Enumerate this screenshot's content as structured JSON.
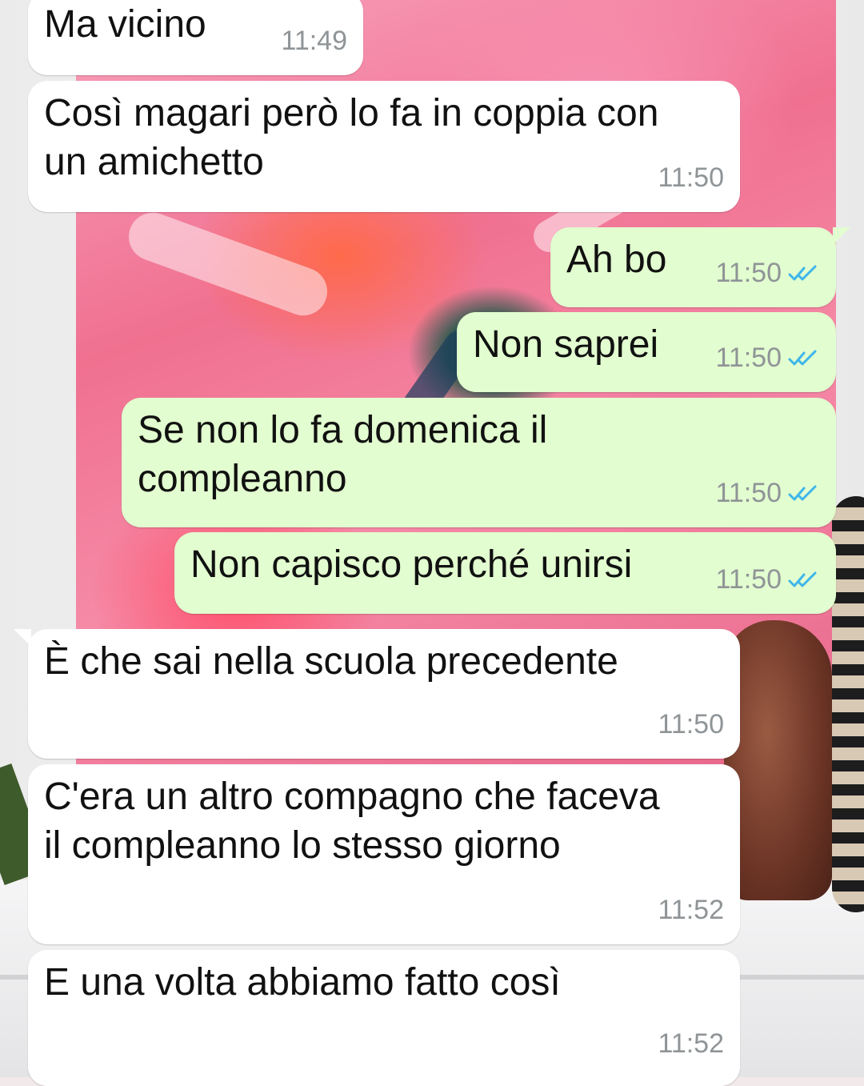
{
  "colors": {
    "incoming_bubble": "#ffffff",
    "outgoing_bubble": "#e2fdcf",
    "timestamp": "#8f9497",
    "read_ticks": "#3fb6ea"
  },
  "messages": [
    {
      "direction": "in",
      "text": "Ma vicino",
      "time": "11:49"
    },
    {
      "direction": "in",
      "text": "Così magari però lo fa in coppia con\nun amichetto",
      "time": "11:50"
    },
    {
      "direction": "out",
      "text": "Ah bo",
      "time": "11:50",
      "status": "read-ticks-icon"
    },
    {
      "direction": "out",
      "text": "Non saprei",
      "time": "11:50",
      "status": "read-ticks-icon"
    },
    {
      "direction": "out",
      "text": "Se non lo fa domenica il\ncompleanno",
      "time": "11:50",
      "status": "read-ticks-icon"
    },
    {
      "direction": "out",
      "text": "Non capisco perché unirsi",
      "time": "11:50",
      "status": "read-ticks-icon"
    },
    {
      "direction": "in",
      "text": "È che sai nella scuola precedente",
      "time": "11:50"
    },
    {
      "direction": "in",
      "text": "C'era un altro compagno che faceva\nil compleanno lo stesso giorno",
      "time": "11:52"
    },
    {
      "direction": "in",
      "text": "E una volta abbiamo fatto così",
      "time": "11:52"
    }
  ]
}
